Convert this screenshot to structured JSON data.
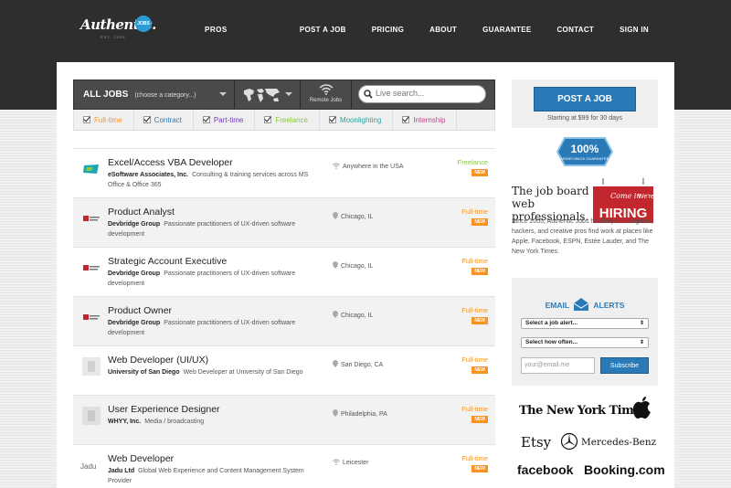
{
  "header": {
    "logo_text": "Authentic.",
    "logo_sub": "EST. 2005",
    "logo_badge": "JOBS",
    "pros_label": "PROS",
    "nav": [
      "POST A JOB",
      "PRICING",
      "ABOUT",
      "GUARANTEE",
      "CONTACT",
      "SIGN IN"
    ]
  },
  "search": {
    "category_label": "ALL JOBS",
    "category_hint": "(choose a category...)",
    "remote_label": "Remote Jobs",
    "placeholder": "Live search..."
  },
  "filters": [
    {
      "label": "Full-time",
      "color": "#f7931e"
    },
    {
      "label": "Contract",
      "color": "#2a7ab8"
    },
    {
      "label": "Part-time",
      "color": "#6a3fb5"
    },
    {
      "label": "Freelance",
      "color": "#8cc63f"
    },
    {
      "label": "Moonlighting",
      "color": "#2ba3a3"
    },
    {
      "label": "Internship",
      "color": "#c0468c"
    }
  ],
  "jobs": [
    {
      "title": "Excel/Access VBA Developer",
      "company": "eSoftware Associates, Inc.",
      "desc": "Consulting & training services across MS Office & Office 365",
      "location": "Anywhere in the USA",
      "type": "Freelance",
      "type_color": "#8cc63f",
      "new": "NEW",
      "loc_icon": "wifi-icon"
    },
    {
      "title": "Product Analyst",
      "company": "Devbridge Group",
      "desc": "Passionate practitioners of UX-driven software development",
      "location": "Chicago, IL",
      "type": "Full-time",
      "type_color": "#f7931e",
      "new": "NEW",
      "loc_icon": "pin-icon"
    },
    {
      "title": "Strategic Account Executive",
      "company": "Devbridge Group",
      "desc": "Passionate practitioners of UX-driven software development",
      "location": "Chicago, IL",
      "type": "Full-time",
      "type_color": "#f7931e",
      "new": "NEW",
      "loc_icon": "pin-icon"
    },
    {
      "title": "Product Owner",
      "company": "Devbridge Group",
      "desc": "Passionate practitioners of UX-driven software development",
      "location": "Chicago, IL",
      "type": "Full-time",
      "type_color": "#f7931e",
      "new": "NEW",
      "loc_icon": "pin-icon"
    },
    {
      "title": "Web Developer (UI/UX)",
      "company": "University of San Diego",
      "desc": "Web Developer at University of San Diego",
      "location": "San Diego, CA",
      "type": "Full-time",
      "type_color": "#f7931e",
      "new": "NEW",
      "loc_icon": "pin-icon"
    },
    {
      "title": "User Experience Designer",
      "company": "WHYY, Inc.",
      "desc": "Media / broadcasting",
      "location": "Philadelphia, PA",
      "type": "Full-time",
      "type_color": "#f7931e",
      "new": "NEW",
      "loc_icon": "pin-icon"
    },
    {
      "title": "Web Developer",
      "company": "Jadu Ltd",
      "desc": "Global Web Experience and Content Management System Provider",
      "location": "Leicester",
      "type": "Full-time",
      "type_color": "#f7931e",
      "new": "NEW",
      "loc_icon": "wifi-icon"
    }
  ],
  "sidebar": {
    "post_button": "POST A JOB",
    "starting_text": "Starting at $99 for 30 days",
    "guarantee": {
      "big": "100%",
      "small": "MONEY-BACK GUARANTEE"
    },
    "tagline": "The job board for web professionals.",
    "hiring_sign": {
      "top": "Come in",
      "middle": "We're",
      "bottom": "HIRING"
    },
    "about": "Since 2005, Authentic Jobs has helped designers, hackers, and creative pros find work at places like Apple, Facebook, ESPN, Estée Lauder, and The New York Times.",
    "email": {
      "left": "EMAIL",
      "right": "ALERTS",
      "select1": "Select a job alert...",
      "select2": "Select how often...",
      "input_placeholder": "your@email.me",
      "subscribe": "Subscribe"
    },
    "brands": [
      "The New York Times",
      "Etsy",
      "Mercedes-Benz",
      "facebook",
      "Booking.com"
    ]
  }
}
